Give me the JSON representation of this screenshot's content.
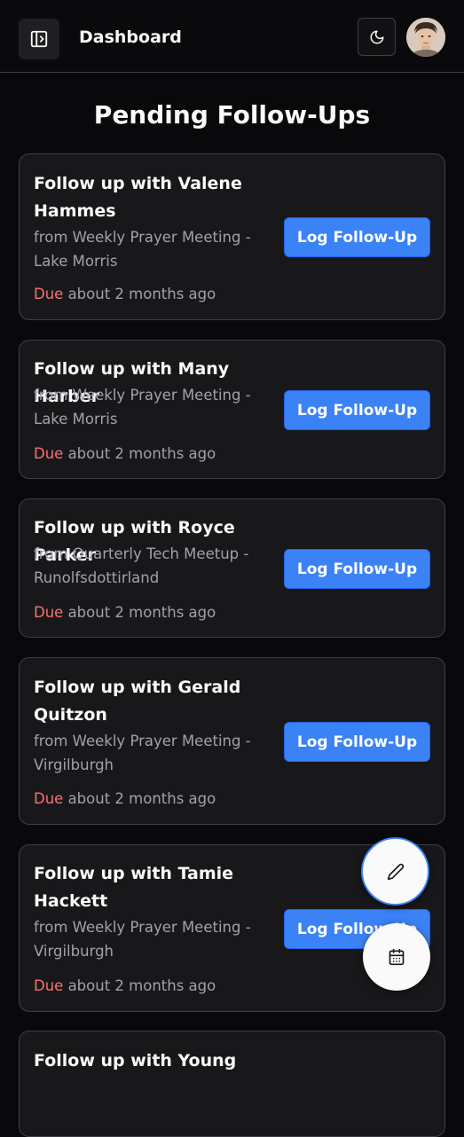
{
  "header": {
    "title": "Dashboard",
    "sidebar_toggle_icon": "panel-right-open-icon",
    "theme_toggle_icon": "moon-icon",
    "avatar_icon": "user-avatar"
  },
  "page": {
    "title": "Pending Follow-Ups"
  },
  "followups": [
    {
      "title": "Follow up with Valene Hammes",
      "from": "from Weekly Prayer Meeting - Lake Morris",
      "due_label": "Due",
      "due_text": " about 2 months ago",
      "button": "Log Follow-Up"
    },
    {
      "title": "Follow up with Many Harber",
      "from": "from Weekly Prayer Meeting - Lake Morris",
      "due_label": "Due",
      "due_text": " about 2 months ago",
      "button": "Log Follow-Up"
    },
    {
      "title": "Follow up with Royce Parker",
      "from": "from Quarterly Tech Meetup - Runolfsdottirland",
      "due_label": "Due",
      "due_text": " about 2 months ago",
      "button": "Log Follow-Up"
    },
    {
      "title": "Follow up with Gerald Quitzon",
      "from": "from Weekly Prayer Meeting - Virgilburgh",
      "due_label": "Due",
      "due_text": " about 2 months ago",
      "button": "Log Follow-Up"
    },
    {
      "title": "Follow up with Tamie Hackett",
      "from": "from Weekly Prayer Meeting - Virgilburgh",
      "due_label": "Due",
      "due_text": " about 2 months ago",
      "button": "Log Follow-Up"
    },
    {
      "title": "Follow up with Young",
      "from": "",
      "due_label": "",
      "due_text": "",
      "button": ""
    }
  ],
  "fabs": {
    "edit_icon": "pencil-icon",
    "calendar_icon": "calendar-icon"
  },
  "colors": {
    "background": "#09090b",
    "card": "#18181b",
    "border": "#3f3f46",
    "accent": "#3b82f6",
    "due": "#f87171",
    "muted_text": "#a1a1aa"
  }
}
